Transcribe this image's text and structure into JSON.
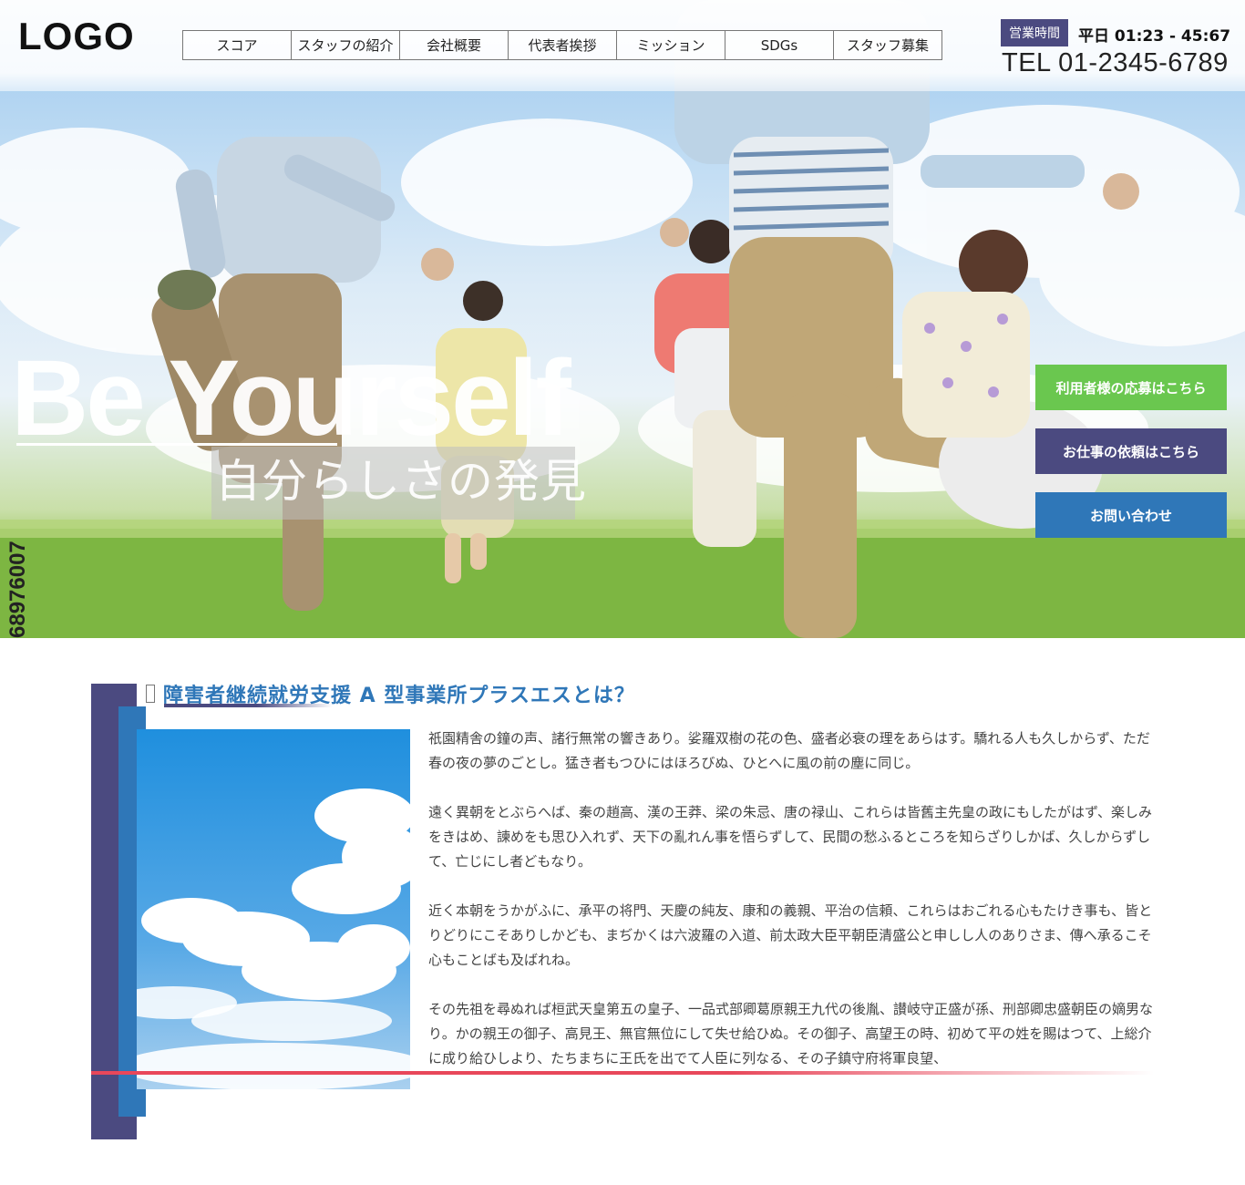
{
  "header": {
    "logo": "LOGO",
    "nav": [
      {
        "label": "スコア"
      },
      {
        "label": "スタッフの紹介"
      },
      {
        "label": "会社概要"
      },
      {
        "label": "代表者挨拶"
      },
      {
        "label": "ミッション"
      },
      {
        "label": "SDGs"
      },
      {
        "label": "スタッフ募集"
      }
    ],
    "hours_label": "営業時間",
    "hours_value": "平日 01:23 - 45:67",
    "tel": "TEL 01-2345-6789"
  },
  "hero": {
    "catch_en": "Be Yourself",
    "catch_ja": "自分らしさの発見",
    "photo_id": "68976007",
    "cta": {
      "apply": "利用者様の応募はこちら",
      "request": "お仕事の依頼はこちら",
      "contact": "お問い合わせ"
    }
  },
  "about": {
    "title": "障害者継続就労支援 A 型事業所プラスエスとは？",
    "paragraphs": [
      "祇園精舎の鐘の声、諸行無常の響きあり。娑羅双樹の花の色、盛者必衰の理をあらはす。驕れる人も久しからず、ただ春の夜の夢のごとし。猛き者もつひにはほろびぬ、ひとへに風の前の塵に同じ。",
      "遠く異朝をとぶらへば、秦の趙高、漢の王莽、梁の朱忌、唐の禄山、これらは皆舊主先皇の政にもしたがはず、楽しみをきはめ、諫めをも思ひ入れず、天下の亂れん事を悟らずして、民間の愁ふるところを知らざりしかば、久しからずして、亡じにし者どもなり。",
      "近く本朝をうかがふに、承平の将門、天慶の純友、康和の義親、平治の信頼、これらはおごれる心もたけき事も、皆とりどりにこそありしかども、まぢかくは六波羅の入道、前太政大臣平朝臣清盛公と申しし人のありさま、傳へ承るこそ心もことばも及ばれね。",
      "その先祖を尋ぬれば桓武天皇第五の皇子、一品式部卿葛原親王九代の後胤、讃岐守正盛が孫、刑部卿忠盛朝臣の嫡男なり。かの親王の御子、高見王、無官無位にして失せ給ひぬ。その御子、高望王の時、初めて平の姓を賜はつて、上総介に成り給ひしより、たちまちに王氏を出でて人臣に列なる、その子鎮守府将軍良望、"
    ]
  },
  "colors": {
    "navy": "#4b4a80",
    "blue": "#2f77b8",
    "green": "#6ac74f",
    "red": "#e8475a"
  }
}
